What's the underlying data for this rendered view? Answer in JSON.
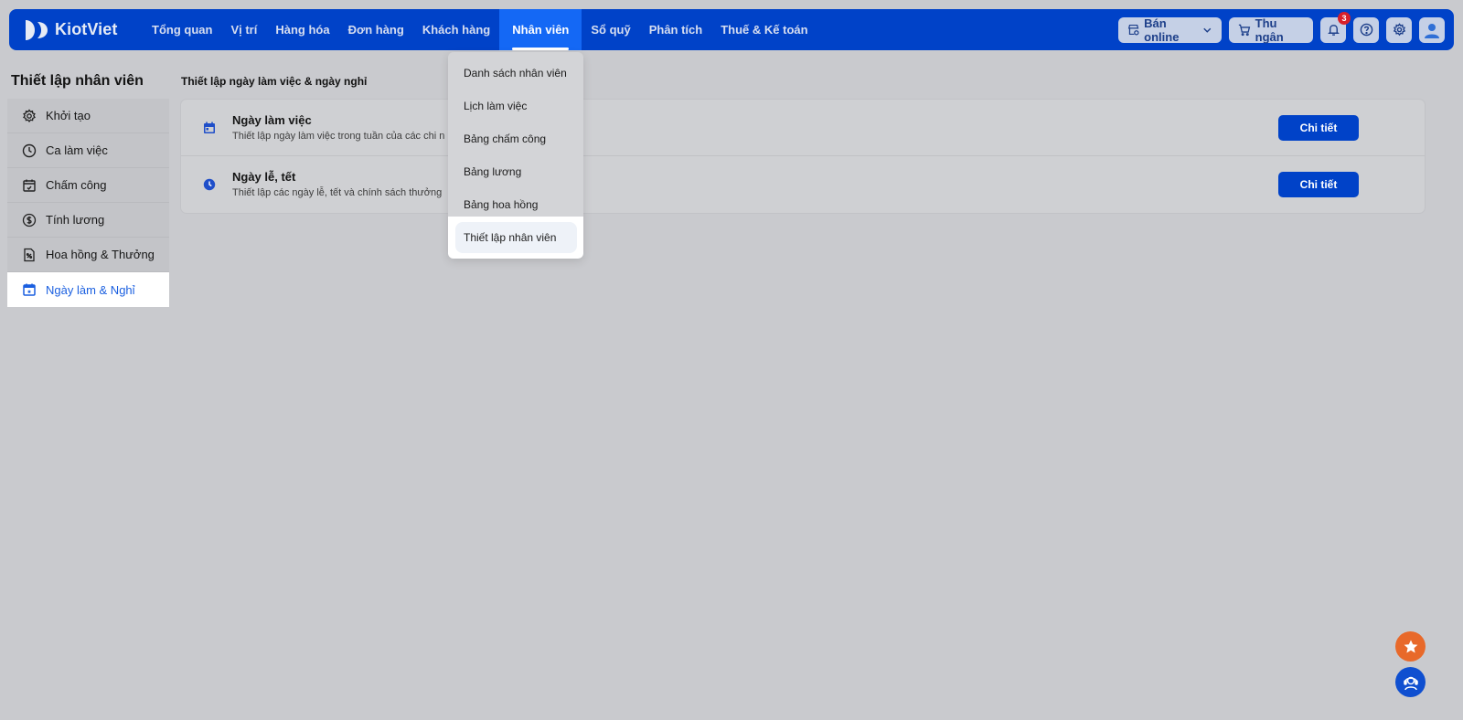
{
  "app": {
    "logo_text": "KiotViet"
  },
  "topnav": {
    "items": [
      "Tổng quan",
      "Vị trí",
      "Hàng hóa",
      "Đơn hàng",
      "Khách hàng",
      "Nhân viên",
      "Sổ quỹ",
      "Phân tích",
      "Thuế & Kế toán"
    ],
    "active": "Nhân viên",
    "online_label": "Bán online",
    "cashier_label": "Thu ngân",
    "notification_count": "3"
  },
  "dropdown": {
    "items": [
      "Danh sách nhân viên",
      "Lịch làm việc",
      "Bảng chấm công",
      "Bảng lương",
      "Bảng hoa hồng",
      "Thiết lập nhân viên"
    ],
    "selected": "Thiết lập nhân viên"
  },
  "sidebar": {
    "title": "Thiết lập nhân viên",
    "items": [
      {
        "label": "Khởi tạo",
        "icon": "gear-icon"
      },
      {
        "label": "Ca làm việc",
        "icon": "clock-icon"
      },
      {
        "label": "Chấm công",
        "icon": "calendar-check-icon"
      },
      {
        "label": "Tính lương",
        "icon": "dollar-icon"
      },
      {
        "label": "Hoa hồng & Thưởng",
        "icon": "percent-doc-icon"
      },
      {
        "label": "Ngày làm & Nghỉ",
        "icon": "calendar-icon"
      }
    ],
    "active": "Ngày làm & Nghỉ"
  },
  "main": {
    "section_title": "Thiết lập ngày làm việc & ngày nghỉ",
    "rows": [
      {
        "title": "Ngày làm việc",
        "desc": "Thiết lập ngày làm việc trong tuần của các chi n",
        "button": "Chi tiết",
        "icon": "calendar-icon"
      },
      {
        "title": "Ngày lễ, tết",
        "desc": "Thiết lập các ngày lễ, tết và chính sách thưởng",
        "button": "Chi tiết",
        "icon": "clock-icon"
      }
    ]
  },
  "colors": {
    "brand": "#0042c8",
    "active_tab": "#1468f5",
    "accent_blue": "#1a5fe0",
    "star_fab": "#e8692a",
    "badge": "#d8202a"
  }
}
